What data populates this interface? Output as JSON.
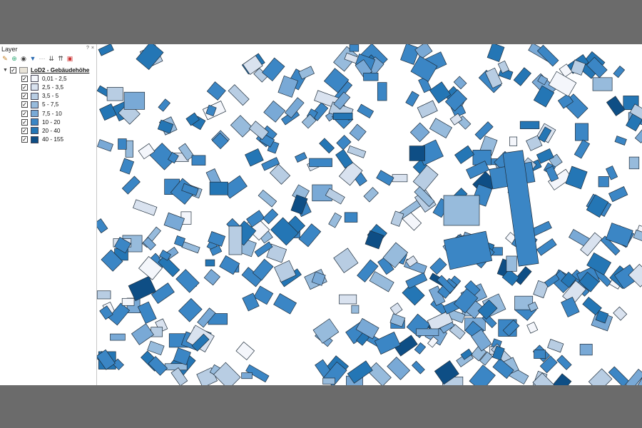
{
  "panel": {
    "title": "Layer",
    "dock_buttons": [
      "?",
      "×"
    ],
    "toolbar_icons": [
      "paint-brush-icon",
      "add-layer-icon",
      "eye-icon",
      "filter-icon",
      "filter-legend-icon",
      "expand-all-icon",
      "collapse-all-icon",
      "remove-layer-icon"
    ]
  },
  "layer_group": {
    "name": "LoD2 - Gebäudehöhe",
    "checked": true,
    "expanded": true
  },
  "legend": [
    {
      "label": "0,01 - 2,5",
      "color": "#f4f6fb",
      "checked": true
    },
    {
      "label": "2,5 - 3,5",
      "color": "#d9e2ef",
      "checked": true
    },
    {
      "label": "3,5 - 5",
      "color": "#b8cde3",
      "checked": true
    },
    {
      "label": "5 - 7,5",
      "color": "#97bbdc",
      "checked": true
    },
    {
      "label": "7,5 - 10",
      "color": "#79a9d6",
      "checked": true
    },
    {
      "label": "10 - 20",
      "color": "#3b86c5",
      "checked": true
    },
    {
      "label": "20 - 40",
      "color": "#2476b5",
      "checked": true
    },
    {
      "label": "40 - 155",
      "color": "#0e4e85",
      "checked": true
    }
  ]
}
